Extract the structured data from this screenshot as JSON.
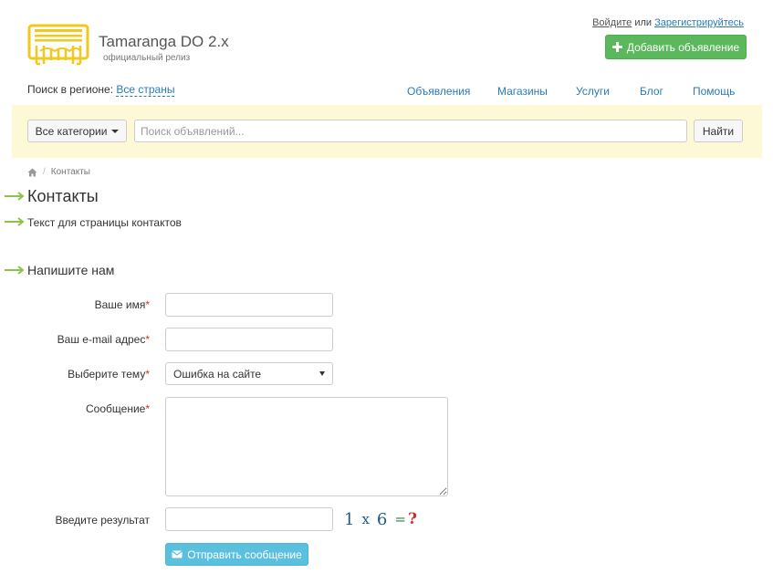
{
  "brand": {
    "title": "Tamaranga DO 2.x",
    "subtitle": "официальный релиз"
  },
  "auth": {
    "login": "Войдите",
    "or": "или",
    "register": "Зарегистрируйтесь"
  },
  "add_button": {
    "label": "Добавить объявление",
    "icon": "plus-icon",
    "color": "#5cb85c"
  },
  "region": {
    "label": "Поиск в регионе:",
    "value": "Все страны"
  },
  "nav": {
    "items": [
      "Объявления",
      "Магазины",
      "Услуги",
      "Блог",
      "Помощь"
    ]
  },
  "search": {
    "category_label": "Все категории",
    "placeholder": "Поиск объявлений...",
    "button": "Найти",
    "bar_color": "#fdf8d5"
  },
  "breadcrumb": {
    "home_icon": "home-icon",
    "separator": "/",
    "current": "Контакты"
  },
  "page": {
    "title": "Контакты",
    "text": "Текст для страницы контактов",
    "form_title": "Напишите нам",
    "arrow_color": "#8bc34a"
  },
  "form": {
    "name_label": "Ваше имя",
    "email_label": "Ваш e-mail адрес",
    "topic_label": "Выберите тему",
    "topic_value": "Ошибка на сайте",
    "message_label": "Сообщение",
    "required_mark": "*",
    "captcha_label": "Введите результат",
    "captcha": {
      "a": "1",
      "op": "x",
      "b": "6",
      "eq": "=",
      "q": "?"
    },
    "submit": "Отправить сообщение",
    "submit_icon": "mail-icon"
  }
}
